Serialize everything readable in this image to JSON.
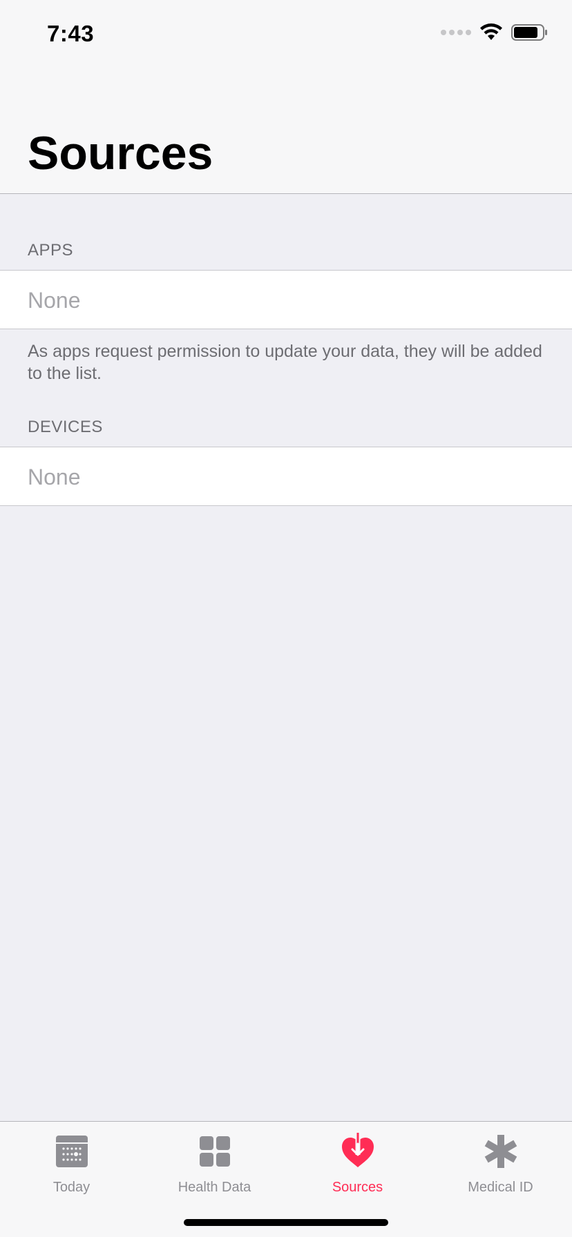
{
  "status_bar": {
    "time": "7:43"
  },
  "header": {
    "title": "Sources"
  },
  "sections": {
    "apps": {
      "header": "APPS",
      "empty_label": "None",
      "footer": "As apps request permission to update your data, they will be added to the list."
    },
    "devices": {
      "header": "DEVICES",
      "empty_label": "None"
    }
  },
  "tab_bar": {
    "active": "Sources",
    "accent_color": "#ff2d55",
    "items": [
      {
        "label": "Today",
        "icon": "calendar-icon"
      },
      {
        "label": "Health Data",
        "icon": "grid-icon"
      },
      {
        "label": "Sources",
        "icon": "heart-arrow-icon"
      },
      {
        "label": "Medical ID",
        "icon": "asterisk-icon"
      }
    ]
  }
}
